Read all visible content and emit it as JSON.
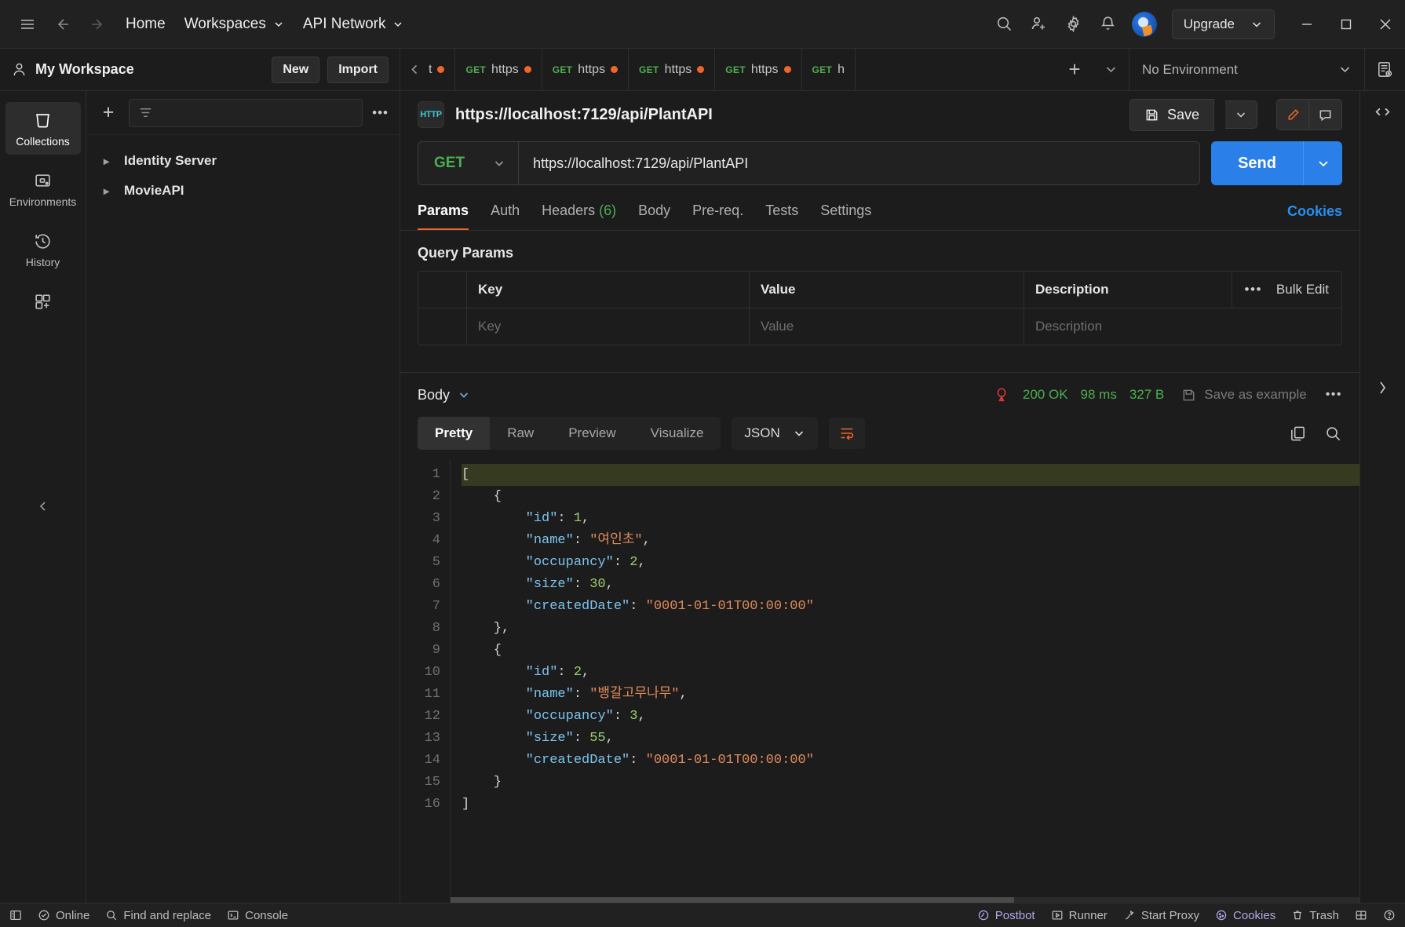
{
  "topbar": {
    "hamburger_icon": "hamburger-icon",
    "back_icon": "arrow-left-icon",
    "forward_icon": "arrow-right-icon",
    "home_label": "Home",
    "workspaces_label": "Workspaces",
    "api_network_label": "API Network",
    "search_icon": "search-icon",
    "invite_icon": "invite-user-icon",
    "settings_icon": "gear-icon",
    "notifications_icon": "bell-icon",
    "avatar": "avatar",
    "upgrade_label": "Upgrade",
    "minimize_icon": "minimize-icon",
    "maximize_icon": "maximize-icon",
    "close_icon": "close-icon"
  },
  "workspace": {
    "person_icon": "person-icon",
    "name": "My Workspace",
    "new_label": "New",
    "import_label": "Import"
  },
  "tabbar": {
    "scroll_left_icon": "chevron-left-icon",
    "scroll_right_icon": "chevron-right-icon",
    "add_icon": "plus-icon",
    "list_caret_icon": "chevron-down-icon",
    "tabs": [
      {
        "method": "",
        "label": "t",
        "dirty": true
      },
      {
        "method": "GET",
        "label": "https",
        "dirty": true
      },
      {
        "method": "GET",
        "label": "https",
        "dirty": true
      },
      {
        "method": "GET",
        "label": "https",
        "dirty": true
      },
      {
        "method": "GET",
        "label": "https",
        "dirty": true
      },
      {
        "method": "GET",
        "label": "h",
        "dirty": false
      }
    ],
    "environment": "No Environment",
    "env_caret_icon": "chevron-down-icon",
    "env_quicklook_icon": "environment-quick-look-icon"
  },
  "rail": {
    "items": [
      {
        "label": "Collections",
        "icon": "collections-icon",
        "active": true
      },
      {
        "label": "Environments",
        "icon": "environments-icon",
        "active": false
      },
      {
        "label": "History",
        "icon": "history-icon",
        "active": false
      },
      {
        "label": "",
        "icon": "apps-grid-icon",
        "active": false
      }
    ],
    "collapse_icon": "chevron-left-icon"
  },
  "sidebar": {
    "add_icon": "plus-icon",
    "filter_icon": "filter-icon",
    "search_placeholder": "",
    "more_icon": "more-horizontal-icon",
    "collections": [
      {
        "name": "Identity Server",
        "expand_icon": "chevron-right-icon"
      },
      {
        "name": "MovieAPI",
        "expand_icon": "chevron-right-icon"
      }
    ]
  },
  "request": {
    "protocol_badge": "HTTP",
    "title": "https://localhost:7129/api/PlantAPI",
    "save_label": "Save",
    "save_icon": "save-icon",
    "save_caret_icon": "chevron-down-icon",
    "edit_icon": "pencil-icon",
    "comment_icon": "comment-icon",
    "method": "GET",
    "method_caret_icon": "chevron-down-icon",
    "url": "https://localhost:7129/api/PlantAPI",
    "send_label": "Send",
    "send_caret_icon": "chevron-down-icon",
    "tabs": [
      {
        "label": "Params",
        "count": "",
        "active": true
      },
      {
        "label": "Auth",
        "count": "",
        "active": false
      },
      {
        "label": "Headers",
        "count": "(6)",
        "active": false
      },
      {
        "label": "Body",
        "count": "",
        "active": false
      },
      {
        "label": "Pre-req.",
        "count": "",
        "active": false
      },
      {
        "label": "Tests",
        "count": "",
        "active": false
      },
      {
        "label": "Settings",
        "count": "",
        "active": false
      }
    ],
    "cookies_label": "Cookies",
    "query_params_title": "Query Params",
    "table_headers": {
      "key": "Key",
      "value": "Value",
      "description": "Description"
    },
    "table_placeholder_row": {
      "key": "Key",
      "value": "Value",
      "description": "Description"
    },
    "bulk_edit_label": "Bulk Edit",
    "bulk_more_icon": "more-horizontal-icon"
  },
  "response": {
    "body_label": "Body",
    "body_caret_icon": "chevron-down-icon",
    "warning_icon": "response-warning-icon",
    "status": "200 OK",
    "time": "98 ms",
    "size": "327 B",
    "save_example_label": "Save as example",
    "save_example_icon": "save-icon",
    "more_icon": "more-horizontal-icon",
    "format_tabs": [
      {
        "label": "Pretty",
        "active": true
      },
      {
        "label": "Raw",
        "active": false
      },
      {
        "label": "Preview",
        "active": false
      },
      {
        "label": "Visualize",
        "active": false
      }
    ],
    "language": "JSON",
    "language_caret_icon": "chevron-down-icon",
    "wrap_icon": "word-wrap-icon",
    "copy_icon": "copy-icon",
    "search_icon": "search-icon",
    "expand_icon": "chevron-right-icon",
    "body_json": [
      {
        "n": 1,
        "tokens": [
          {
            "t": "p",
            "v": "["
          }
        ],
        "highlight": true
      },
      {
        "n": 2,
        "tokens": [
          {
            "t": "p",
            "v": "    {"
          }
        ]
      },
      {
        "n": 3,
        "tokens": [
          {
            "t": "k",
            "v": "        \"id\""
          },
          {
            "t": "p",
            "v": ": "
          },
          {
            "t": "n",
            "v": "1"
          },
          {
            "t": "p",
            "v": ","
          }
        ]
      },
      {
        "n": 4,
        "tokens": [
          {
            "t": "k",
            "v": "        \"name\""
          },
          {
            "t": "p",
            "v": ": "
          },
          {
            "t": "s",
            "v": "\"여인초\""
          },
          {
            "t": "p",
            "v": ","
          }
        ]
      },
      {
        "n": 5,
        "tokens": [
          {
            "t": "k",
            "v": "        \"occupancy\""
          },
          {
            "t": "p",
            "v": ": "
          },
          {
            "t": "n",
            "v": "2"
          },
          {
            "t": "p",
            "v": ","
          }
        ]
      },
      {
        "n": 6,
        "tokens": [
          {
            "t": "k",
            "v": "        \"size\""
          },
          {
            "t": "p",
            "v": ": "
          },
          {
            "t": "n",
            "v": "30"
          },
          {
            "t": "p",
            "v": ","
          }
        ]
      },
      {
        "n": 7,
        "tokens": [
          {
            "t": "k",
            "v": "        \"createdDate\""
          },
          {
            "t": "p",
            "v": ": "
          },
          {
            "t": "s",
            "v": "\"0001-01-01T00:00:00\""
          }
        ]
      },
      {
        "n": 8,
        "tokens": [
          {
            "t": "p",
            "v": "    },"
          }
        ]
      },
      {
        "n": 9,
        "tokens": [
          {
            "t": "p",
            "v": "    {"
          }
        ]
      },
      {
        "n": 10,
        "tokens": [
          {
            "t": "k",
            "v": "        \"id\""
          },
          {
            "t": "p",
            "v": ": "
          },
          {
            "t": "n",
            "v": "2"
          },
          {
            "t": "p",
            "v": ","
          }
        ]
      },
      {
        "n": 11,
        "tokens": [
          {
            "t": "k",
            "v": "        \"name\""
          },
          {
            "t": "p",
            "v": ": "
          },
          {
            "t": "s",
            "v": "\"뱅갈고무나무\""
          },
          {
            "t": "p",
            "v": ","
          }
        ]
      },
      {
        "n": 12,
        "tokens": [
          {
            "t": "k",
            "v": "        \"occupancy\""
          },
          {
            "t": "p",
            "v": ": "
          },
          {
            "t": "n",
            "v": "3"
          },
          {
            "t": "p",
            "v": ","
          }
        ]
      },
      {
        "n": 13,
        "tokens": [
          {
            "t": "k",
            "v": "        \"size\""
          },
          {
            "t": "p",
            "v": ": "
          },
          {
            "t": "n",
            "v": "55"
          },
          {
            "t": "p",
            "v": ","
          }
        ]
      },
      {
        "n": 14,
        "tokens": [
          {
            "t": "k",
            "v": "        \"createdDate\""
          },
          {
            "t": "p",
            "v": ": "
          },
          {
            "t": "s",
            "v": "\"0001-01-01T00:00:00\""
          }
        ]
      },
      {
        "n": 15,
        "tokens": [
          {
            "t": "p",
            "v": "    }"
          }
        ]
      },
      {
        "n": 16,
        "tokens": [
          {
            "t": "p",
            "v": "]"
          }
        ]
      }
    ]
  },
  "statusbar": {
    "left": [
      {
        "label": "",
        "icon": "sidebar-toggle-icon",
        "accent": false
      },
      {
        "label": "Online",
        "icon": "online-check-icon",
        "accent": false
      },
      {
        "label": "Find and replace",
        "icon": "search-icon",
        "accent": false
      },
      {
        "label": "Console",
        "icon": "console-icon",
        "accent": false
      }
    ],
    "right": [
      {
        "label": "Postbot",
        "icon": "postbot-icon",
        "accent": true
      },
      {
        "label": "Runner",
        "icon": "runner-icon",
        "accent": false
      },
      {
        "label": "Start Proxy",
        "icon": "proxy-icon",
        "accent": false
      },
      {
        "label": "Cookies",
        "icon": "cookie-icon",
        "accent": true
      },
      {
        "label": "Trash",
        "icon": "trash-icon",
        "accent": false
      },
      {
        "label": "",
        "icon": "layout-grid-icon",
        "accent": false
      },
      {
        "label": "",
        "icon": "help-icon",
        "accent": false
      }
    ]
  },
  "colors": {
    "accent_orange": "#f06529",
    "send_blue": "#2a7fe8",
    "success_green": "#4caf50",
    "link_blue": "#2a8fef",
    "error_red": "#e53935"
  }
}
